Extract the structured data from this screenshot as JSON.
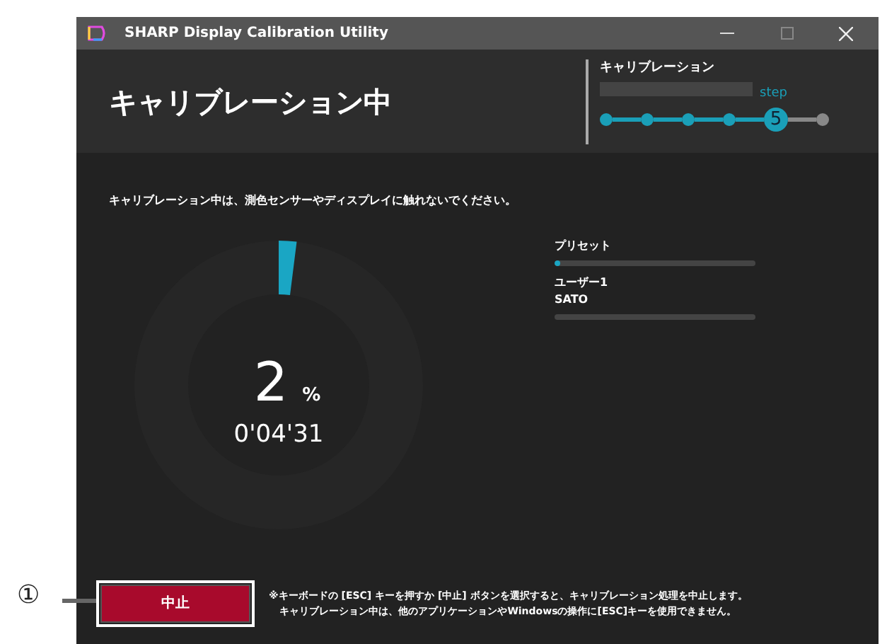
{
  "window": {
    "title": "SHARP Display Calibration Utility"
  },
  "header": {
    "title": "キャリブレーション中",
    "step_panel": {
      "label": "キャリブレーション",
      "step_caption": "step",
      "steps": [
        {
          "completed": true,
          "selected": false
        },
        {
          "completed": true,
          "selected": false
        },
        {
          "completed": true,
          "selected": false
        },
        {
          "completed": true,
          "selected": false
        },
        {
          "label": "5",
          "completed": true,
          "selected": true
        },
        {
          "completed": false,
          "selected": false
        }
      ]
    }
  },
  "notice": "キャリブレーション中は、測色センサーやディスプレイに触れないでください。",
  "progress": {
    "level": 0.02,
    "percent": "2",
    "unit": "%",
    "time": "0'04'31"
  },
  "tasks": [
    {
      "name": "プリセット",
      "level": 0.03
    },
    {
      "name": "ユーザー1",
      "sub": "SATO",
      "level": 0
    }
  ],
  "footer": {
    "button": "中止",
    "notes": [
      "※キーボードの [ESC] キーを押すか [中止] ボタンを選択すると、キャリブレーション処理を中止します。",
      "キャリブレーション中は、他のアプリケーションやWindowsの操作に[ESC]キーを使用できません。"
    ]
  },
  "callout": "①"
}
